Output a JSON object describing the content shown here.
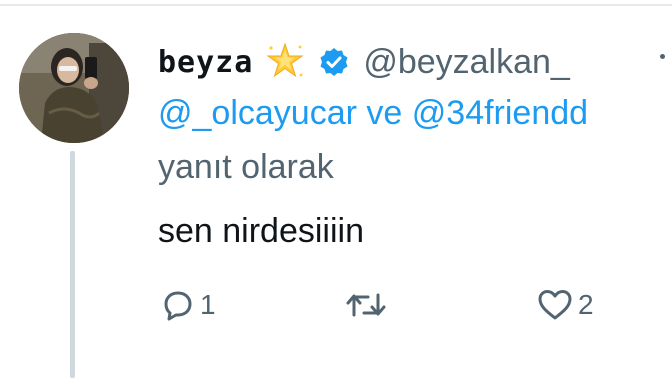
{
  "tweet": {
    "display_name": "beyza",
    "emoji_icon": "star-icon",
    "verified_icon": "verified-badge-icon",
    "handle": "@beyzalkan_",
    "reply_to": {
      "users": [
        "@_olcayucar",
        "@34friendd"
      ],
      "joiner": "ve",
      "suffix": "yanıt olarak"
    },
    "text": "sen nirdesiiiin",
    "actions": {
      "reply_count": "1",
      "retweet_count": "",
      "like_count": "2"
    }
  },
  "colors": {
    "link": "#1d9bf0",
    "muted": "#536471",
    "text": "#0f1419",
    "thread_line": "#cfd9de"
  }
}
